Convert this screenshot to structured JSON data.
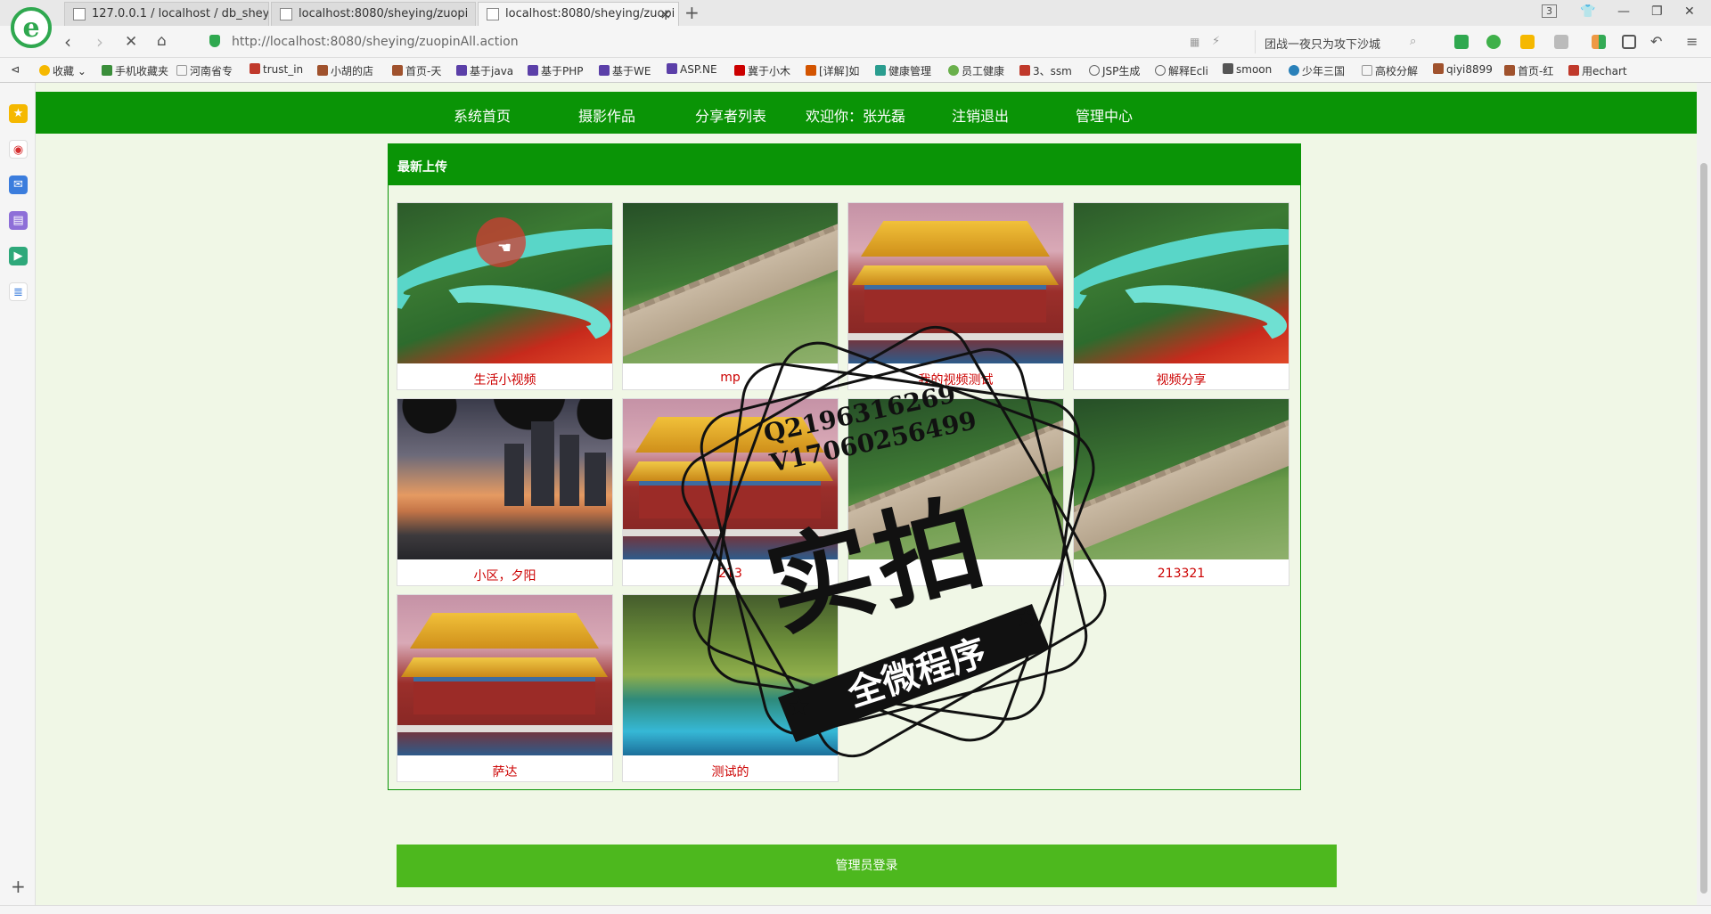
{
  "browser": {
    "tabs": [
      {
        "title": "127.0.0.1 / localhost / db_shey",
        "active": false
      },
      {
        "title": "localhost:8080/sheying/zuopi",
        "active": false
      },
      {
        "title": "localhost:8080/sheying/zuopi",
        "active": true
      }
    ],
    "tab_count_badge": "3",
    "url": "http://localhost:8080/sheying/zuopinAll.action",
    "search_text": "团战一夜只为攻下沙城",
    "bookmarks": [
      "收藏",
      "手机收藏夹",
      "河南省专",
      "trust_in",
      "小胡的店",
      "首页-天",
      "基于java",
      "基于PHP",
      "基于WE",
      "ASP.NE",
      "冀于小木",
      "[详解]如",
      "健康管理",
      "员工健康",
      "3、ssm",
      "JSP生成",
      "解释Ecli",
      "smoon",
      "少年三国",
      "高校分解",
      "qiyi8899",
      "首页-红",
      "用echart"
    ],
    "colors": {
      "accent_green": "#2fa84f"
    }
  },
  "site": {
    "nav": {
      "home": "系统首页",
      "works": "摄影作品",
      "sharers": "分享者列表",
      "welcome": "欢迎你：张光磊",
      "logout": "注销退出",
      "admin": "管理中心"
    },
    "panel_title": "最新上传",
    "works": [
      {
        "caption": "生活小视频",
        "scene": "river"
      },
      {
        "caption": "mp",
        "scene": "wall"
      },
      {
        "caption": "我的视频测试",
        "scene": "palace"
      },
      {
        "caption": "视频分享",
        "scene": "river"
      },
      {
        "caption": "小区，夕阳",
        "scene": "sunset"
      },
      {
        "caption": "213",
        "scene": "palace"
      },
      {
        "caption": "",
        "scene": "wall"
      },
      {
        "caption": "213321",
        "scene": "wall"
      },
      {
        "caption": "萨达",
        "scene": "palace"
      },
      {
        "caption": "测试的",
        "scene": "lake"
      }
    ],
    "admin_login": "管理员登录",
    "colors": {
      "nav_green": "#0a9406",
      "caption_red": "#cc0000",
      "button_green": "#4db81e",
      "page_bg": "#f0f7e6"
    }
  },
  "watermark": {
    "contact": "Q2196316269\nV17060256499",
    "big": "实拍",
    "ribbon": "全微程序"
  }
}
